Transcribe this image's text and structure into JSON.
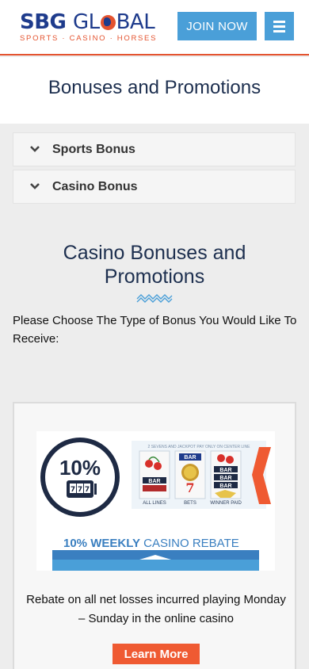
{
  "header": {
    "logo": {
      "brand_bold": "SBG",
      "brand_g": "GL",
      "brand_rest": "BAL",
      "tagline": "SPORTS · CASINO · HORSES"
    },
    "join_label": "JOIN NOW"
  },
  "page": {
    "title": "Bonuses and Promotions"
  },
  "accordion": [
    {
      "label": "Sports Bonus"
    },
    {
      "label": "Casino Bonus"
    }
  ],
  "section": {
    "title": "Casino Bonuses and Promotions",
    "instruction": "Please Choose The Type of Bonus You Would Like To Receive:"
  },
  "promo": {
    "banner": {
      "badge": "10%",
      "reels_caption": "2 SEVENS AND JACKPOT PAY ONLY ON CENTER LINE",
      "reel_labels": [
        "ALL LINES",
        "BETS",
        "WINNER PAID"
      ],
      "reel_symbols": [
        "BAR",
        "BAR",
        "BAR",
        "BAR",
        "BAR"
      ],
      "headline_bold": "10% WEEKLY",
      "headline_rest": "CASINO REBATE"
    },
    "description": "Rebate on all net losses incurred playing Monday – Sunday in the online casino",
    "cta": "Learn More"
  },
  "colors": {
    "accent": "#e4532f",
    "brand": "#1e3b8c",
    "button": "#4a9fd8",
    "cta": "#ef5a32"
  }
}
